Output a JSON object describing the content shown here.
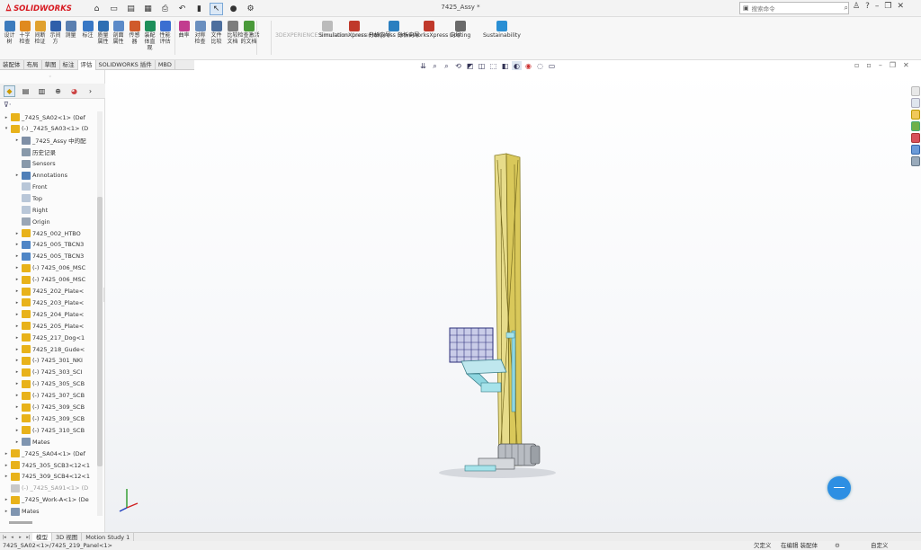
{
  "titlebar": {
    "brand": "SOLIDWORKS",
    "document_title": "7425_Assy *",
    "search_placeholder": "搜索命令"
  },
  "command_manager": {
    "tools": [
      {
        "label": "设计\n树",
        "icon": "design-tree-icon",
        "color": "#3c7bbd"
      },
      {
        "label": "十字\n检查",
        "icon": "crosshair-icon",
        "color": "#e08a1e"
      },
      {
        "label": "间断\n检证",
        "icon": "gap-check-icon",
        "color": "#e0a12e"
      },
      {
        "label": "示间\n方",
        "icon": "clearance-icon",
        "color": "#2f5faa"
      },
      {
        "label": "测量",
        "icon": "measure-icon",
        "color": "#5a7fb0"
      },
      {
        "label": "标注",
        "icon": "markup-icon",
        "color": "#3777c5"
      },
      {
        "label": "质量\n属性",
        "icon": "mass-properties-icon",
        "color": "#2e6fb3"
      },
      {
        "label": "剖面\n属性",
        "icon": "section-properties-icon",
        "color": "#5b8ac8"
      },
      {
        "label": "传感\n器",
        "icon": "sensor-icon",
        "color": "#d05a2a"
      },
      {
        "label": "装配\n体直\n观",
        "icon": "assembly-visualization-icon",
        "color": "#1e8f5a"
      },
      {
        "label": "性能\n评估",
        "icon": "performance-icon",
        "color": "#3b6fd1"
      },
      {
        "label": "曲率",
        "icon": "curvature-icon",
        "color": "#c23c8f"
      },
      {
        "label": "对称\n检查",
        "icon": "symmetry-check-icon",
        "color": "#6a8fbf"
      },
      {
        "label": "文件\n比较",
        "icon": "compare-icon",
        "color": "#4d6f9e"
      },
      {
        "label": "比较\n文档",
        "icon": "compare-documents-icon",
        "color": "#7d7d7d"
      },
      {
        "label": "检查激活\n的文档",
        "icon": "check-document-icon",
        "color": "#4a9a3a"
      }
    ],
    "wide_tools": [
      {
        "label": "3DEXPERIENCE\nSimulation\nConnector",
        "icon": "3dexperience-icon",
        "color": "#bbbbbb",
        "disabled": true
      },
      {
        "label": "SimulationXpress\n分析向导",
        "icon": "simulationxpress-icon",
        "color": "#c0392b",
        "disabled": false
      },
      {
        "label": "FloXpress\n分析向导",
        "icon": "floxpress-icon",
        "color": "#2a7fc0",
        "disabled": false
      },
      {
        "label": "DriveWorksXpress\n向导",
        "icon": "driveworks-icon",
        "color": "#c0392b",
        "disabled": false
      },
      {
        "label": "Costing",
        "icon": "costing-icon",
        "color": "#6a6a6a",
        "disabled": false
      },
      {
        "label": "Sustainability",
        "icon": "sustainability-icon",
        "color": "#2a8fd4",
        "disabled": false
      }
    ],
    "tabs": [
      "装配体",
      "布局",
      "草图",
      "标注",
      "评估",
      "SOLIDWORKS 插件",
      "MBD"
    ],
    "active_tab": "评估"
  },
  "feature_tree": {
    "rows": [
      {
        "text": "_7425_SA02<1> (Def",
        "icon": "subassembly-icon",
        "color": "#e8b21a",
        "exp": "▸",
        "indent": 0
      },
      {
        "text": "(-) _7425_SA03<1> (D",
        "icon": "subassembly-icon",
        "color": "#e8b21a",
        "exp": "▾",
        "indent": 0
      },
      {
        "text": "_7425_Assy 中的配",
        "icon": "history-icon",
        "color": "#7f8fa6",
        "exp": "▸",
        "indent": 1
      },
      {
        "text": "历史记录",
        "icon": "history-icon",
        "color": "#8899aa",
        "exp": "",
        "indent": 1
      },
      {
        "text": "Sensors",
        "icon": "sensor-icon",
        "color": "#8899aa",
        "exp": "",
        "indent": 1
      },
      {
        "text": "Annotations",
        "icon": "annotation-icon",
        "color": "#4f7fb8",
        "exp": "▸",
        "indent": 1
      },
      {
        "text": "Front",
        "icon": "plane-icon",
        "color": "#b9c7d8",
        "exp": "",
        "indent": 1
      },
      {
        "text": "Top",
        "icon": "plane-icon",
        "color": "#b9c7d8",
        "exp": "",
        "indent": 1
      },
      {
        "text": "Right",
        "icon": "plane-icon",
        "color": "#b9c7d8",
        "exp": "",
        "indent": 1
      },
      {
        "text": "Origin",
        "icon": "origin-icon",
        "color": "#9aa6b5",
        "exp": "",
        "indent": 1
      },
      {
        "text": "7425_002_HTBO",
        "icon": "part-icon",
        "color": "#e8b21a",
        "exp": "▸",
        "indent": 1
      },
      {
        "text": "7425_005_TBCN3",
        "icon": "part-icon",
        "color": "#4f86c6",
        "exp": "▸",
        "indent": 1
      },
      {
        "text": "7425_005_TBCN3",
        "icon": "part-icon",
        "color": "#4f86c6",
        "exp": "▸",
        "indent": 1
      },
      {
        "text": "(-) 7425_006_MSC",
        "icon": "part-icon",
        "color": "#e8b21a",
        "exp": "▸",
        "indent": 1
      },
      {
        "text": "(-) 7425_006_MSC",
        "icon": "part-icon",
        "color": "#e8b21a",
        "exp": "▸",
        "indent": 1
      },
      {
        "text": "7425_202_Plate<",
        "icon": "part-icon",
        "color": "#e8b21a",
        "exp": "▸",
        "indent": 1
      },
      {
        "text": "7425_203_Plate<",
        "icon": "part-icon",
        "color": "#e8b21a",
        "exp": "▸",
        "indent": 1
      },
      {
        "text": "7425_204_Plate<",
        "icon": "part-icon",
        "color": "#e8b21a",
        "exp": "▸",
        "indent": 1
      },
      {
        "text": "7425_205_Plate<",
        "icon": "part-icon",
        "color": "#e8b21a",
        "exp": "▸",
        "indent": 1
      },
      {
        "text": "7425_217_Dog<1",
        "icon": "part-icon",
        "color": "#e8b21a",
        "exp": "▸",
        "indent": 1
      },
      {
        "text": "7425_218_Gude<",
        "icon": "part-icon",
        "color": "#e8b21a",
        "exp": "▸",
        "indent": 1
      },
      {
        "text": "(-) 7425_301_NKI",
        "icon": "part-icon",
        "color": "#e8b21a",
        "exp": "▸",
        "indent": 1
      },
      {
        "text": "(-) 7425_303_SCI",
        "icon": "part-icon",
        "color": "#e8b21a",
        "exp": "▸",
        "indent": 1
      },
      {
        "text": "(-) 7425_305_SCB",
        "icon": "part-icon",
        "color": "#e8b21a",
        "exp": "▸",
        "indent": 1
      },
      {
        "text": "(-) 7425_307_SCB",
        "icon": "part-icon",
        "color": "#e8b21a",
        "exp": "▸",
        "indent": 1
      },
      {
        "text": "(-) 7425_309_SCB",
        "icon": "part-icon",
        "color": "#e8b21a",
        "exp": "▸",
        "indent": 1
      },
      {
        "text": "(-) 7425_309_SCB",
        "icon": "part-icon",
        "color": "#e8b21a",
        "exp": "▸",
        "indent": 1
      },
      {
        "text": "(-) 7425_310_SCB",
        "icon": "part-icon",
        "color": "#e8b21a",
        "exp": "▸",
        "indent": 1
      },
      {
        "text": "Mates",
        "icon": "mates-icon",
        "color": "#7f95b0",
        "exp": "▸",
        "indent": 1
      },
      {
        "text": "_7425_SA04<1> (Def",
        "icon": "subassembly-icon",
        "color": "#e8b21a",
        "exp": "▸",
        "indent": 0
      },
      {
        "text": "7425_305_SCB3<12<1",
        "icon": "part-icon",
        "color": "#e8b21a",
        "exp": "▸",
        "indent": 0
      },
      {
        "text": "7425_309_SCB4<12<1",
        "icon": "part-icon",
        "color": "#e8b21a",
        "exp": "▸",
        "indent": 0
      },
      {
        "text": "(-) _7425_SA91<1> (D",
        "icon": "subassembly-icon",
        "color": "#c8c8c8",
        "exp": "",
        "indent": 0,
        "dim": true
      },
      {
        "text": "_7425_Work-A<1> (De",
        "icon": "subassembly-icon",
        "color": "#e8b21a",
        "exp": "▸",
        "indent": 0
      },
      {
        "text": "Mates",
        "icon": "mates-icon",
        "color": "#7f95b0",
        "exp": "▸",
        "indent": 0
      }
    ]
  },
  "bottom_tabs": [
    "模型",
    "3D 视图",
    "Motion Study 1"
  ],
  "active_bottom_tab": "模型",
  "status": {
    "left": "7425_SA02<1>/7425_219_Panel<1>",
    "under_defined": "欠定义",
    "editing": "在编辑 装配体",
    "custom": "自定义"
  },
  "colors": {
    "frame_yellow": "#d9c85a",
    "frame_cyan": "#8ed6e0",
    "brand_red": "#d71920",
    "assistant_blue": "#2d8fe3"
  }
}
